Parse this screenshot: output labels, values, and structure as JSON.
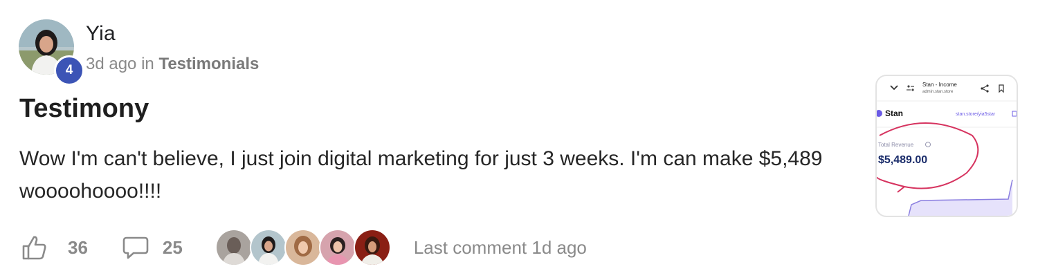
{
  "post": {
    "author": "Yia",
    "level": "4",
    "time": "3d ago",
    "in_label": "in",
    "category": "Testimonials",
    "title": "Testimony",
    "body": "Wow I'm can't believe, I just join digital marketing for just 3 weeks. I'm can make $5,489 woooohoooo!!!!"
  },
  "thumbnail": {
    "tab_title": "Stan - Income",
    "url": "admin.stan.store",
    "brand": "Stan",
    "store_link": "stan.store/yia5star",
    "revenue_label": "Total Revenue",
    "revenue_value": "$5,489.00"
  },
  "footer": {
    "likes": "36",
    "comments": "25",
    "last_comment": "Last comment 1d ago"
  },
  "icons": {
    "like": "thumbs-up-icon",
    "comment": "comment-bubble-icon",
    "level": "level-badge"
  },
  "colors": {
    "level_badge": "#3c54b6",
    "muted_text": "#8a8a8a",
    "revenue": "#1b2d6b",
    "annotation_circle": "#d6335f",
    "chart_line": "#8b7fe0"
  }
}
